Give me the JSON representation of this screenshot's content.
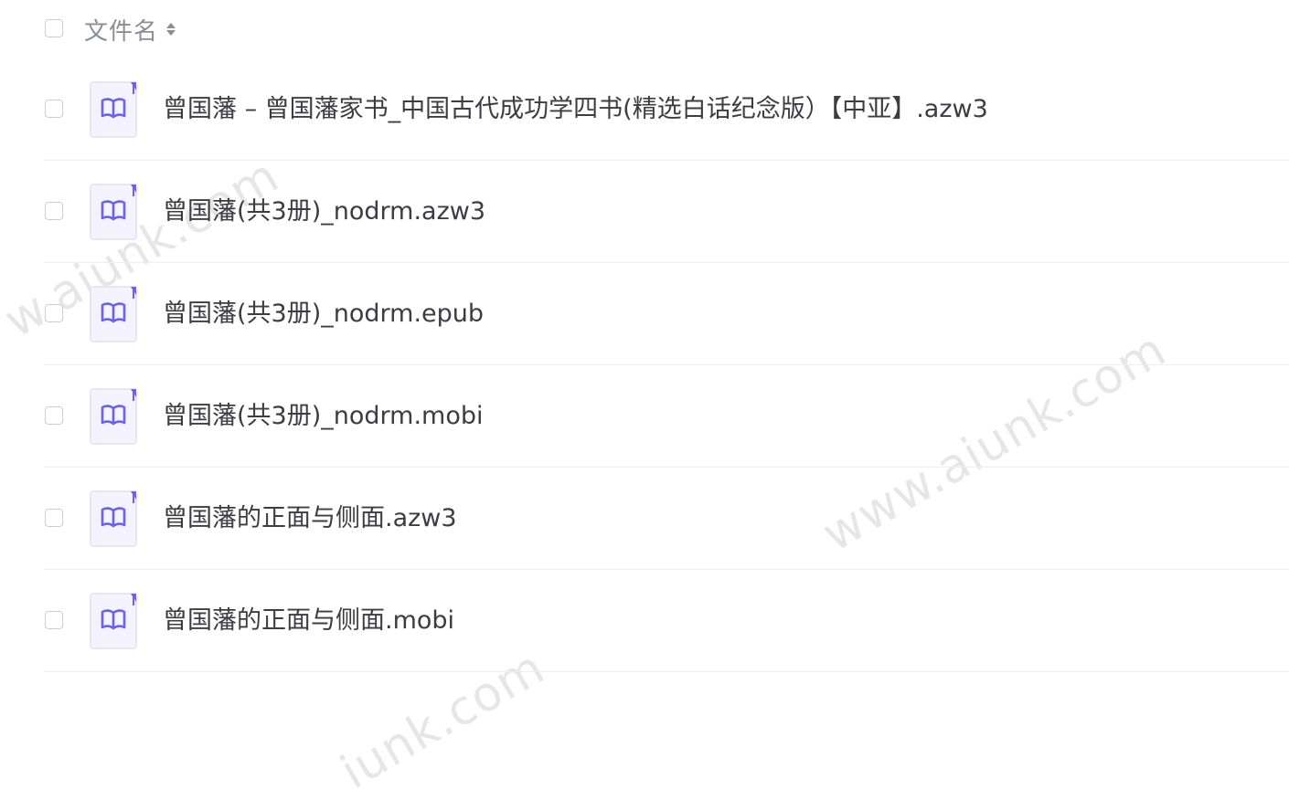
{
  "header": {
    "column_title": "文件名",
    "sort_icon": "sort-updown-icon"
  },
  "files": [
    {
      "name": "曾国藩 – 曾国藩家书_中国古代成功学四书(精选白话纪念版）【中亚】.azw3",
      "icon": "book-icon"
    },
    {
      "name": "曾国藩(共3册)_nodrm.azw3",
      "icon": "book-icon"
    },
    {
      "name": "曾国藩(共3册)_nodrm.epub",
      "icon": "book-icon"
    },
    {
      "name": "曾国藩(共3册)_nodrm.mobi",
      "icon": "book-icon"
    },
    {
      "name": "曾国藩的正面与侧面.azw3",
      "icon": "book-icon"
    },
    {
      "name": "曾国藩的正面与侧面.mobi",
      "icon": "book-icon"
    }
  ],
  "watermark": {
    "text_full": "www.aiunk.com",
    "text_partial_bottom": "iunk.com",
    "text_partial_left": "w.aiunk.com"
  },
  "colors": {
    "icon_accent": "#6b62e8",
    "icon_bg": "#f4f3fd",
    "icon_border": "#e2e0f5"
  }
}
